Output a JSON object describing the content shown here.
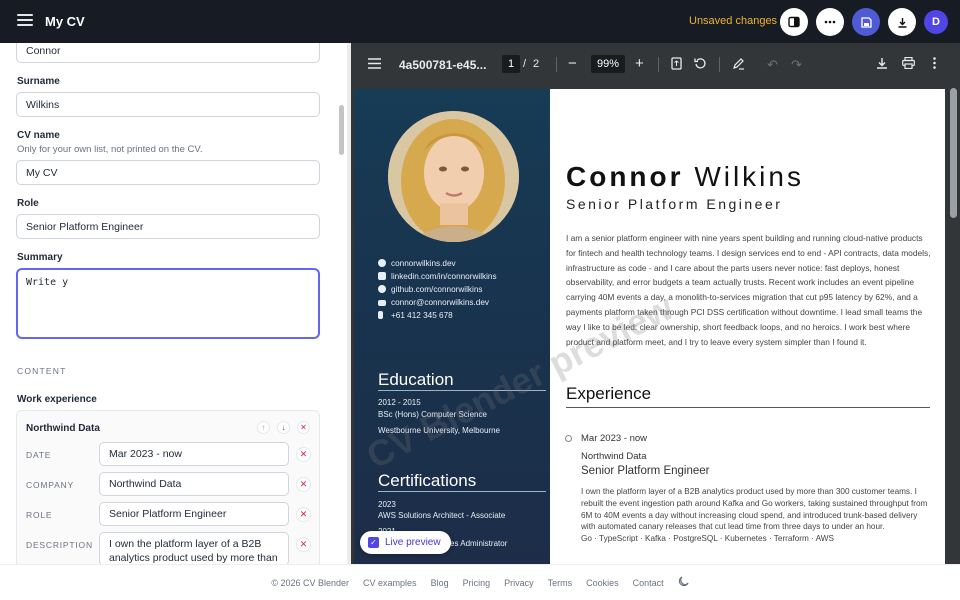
{
  "header": {
    "title": "My CV",
    "status": "Unsaved changes",
    "avatar_initial": "D",
    "icons": [
      "menu-icon",
      "panel-icon",
      "more-icon",
      "save-icon",
      "download-icon"
    ]
  },
  "form": {
    "first_name_value": "Connor",
    "surname_label": "Surname",
    "surname_value": "Wilkins",
    "cvname_label": "CV name",
    "cvname_hint": "Only for your own list, not printed on the CV.",
    "cvname_value": "My CV",
    "role_label": "Role",
    "role_value": "Senior Platform Engineer",
    "summary_label": "Summary",
    "summary_value": "Write y",
    "content_section": "CONTENT",
    "work_label": "Work experience",
    "entry": {
      "title": "Northwind Data",
      "date_label": "DATE",
      "date_value": "Mar 2023 - now",
      "company_label": "COMPANY",
      "company_value": "Northwind Data",
      "role_label": "ROLE",
      "role_value": "Senior Platform Engineer",
      "description_label": "DESCRIPTION",
      "description_value": "I own the platform layer of a B2B analytics product used by more than"
    }
  },
  "pdf": {
    "filename": "4a500781-e45...",
    "page_current": "1",
    "page_sep": "/",
    "page_total": "2",
    "zoom": "99%"
  },
  "cv": {
    "first_name": "Connor",
    "last_name": "Wilkins",
    "role": "Senior Platform Engineer",
    "contacts": [
      "connorwilkins.dev",
      "linkedin.com/in/connorwilkins",
      "github.com/connorwilkins",
      "connor@connorwilkins.dev",
      "+61 412 345 678"
    ],
    "education_heading": "Education",
    "education_years": "2012 - 2015",
    "education_degree": "BSc (Hons) Computer Science",
    "education_school": "Westbourne University, Melbourne",
    "cert_heading": "Certifications",
    "cert_year": "2023",
    "cert_name": "AWS Solutions Architect - Associate",
    "cert_year2": "2021",
    "cert_name2": "es Administrator",
    "summary": "I am a senior platform engineer with nine years spent building and running cloud-native products for fintech and health technology teams. I design services end to end - API contracts, data models, infrastructure as code - and I care about the parts users never notice: fast deploys, honest observability, and error budgets a team actually trusts. Recent work includes an event pipeline carrying 40M events a day, a monolith-to-services migration that cut p95 latency by 62%, and a payments platform taken through PCI DSS certification without downtime. I lead small teams the way I like to be led: clear ownership, short feedback loops, and no heroics. I work best where product and platform meet, and I try to leave every system simpler than I found it.",
    "experience_heading": "Experience",
    "exp_date": "Mar 2023 - now",
    "exp_company": "Northwind Data",
    "exp_role": "Senior Platform Engineer",
    "exp_body": "I own the platform layer of a B2B analytics product used by more than 300 customer teams. I rebuilt the event ingestion path around Kafka and Go workers, taking sustained throughput from 6M to 40M events a day without increasing cloud spend, and introduced trunk-based delivery with automated canary releases that cut lead time from three days to under an hour.",
    "exp_skills": "Go · TypeScript · Kafka · PostgreSQL · Kubernetes · Terraform · AWS",
    "watermark": "CV Blender preview"
  },
  "live_preview": "Live preview",
  "footer": {
    "copyright": "© 2026 CV Blender",
    "links": [
      "CV examples",
      "Blog",
      "Pricing",
      "Privacy",
      "Terms",
      "Cookies",
      "Contact"
    ]
  }
}
